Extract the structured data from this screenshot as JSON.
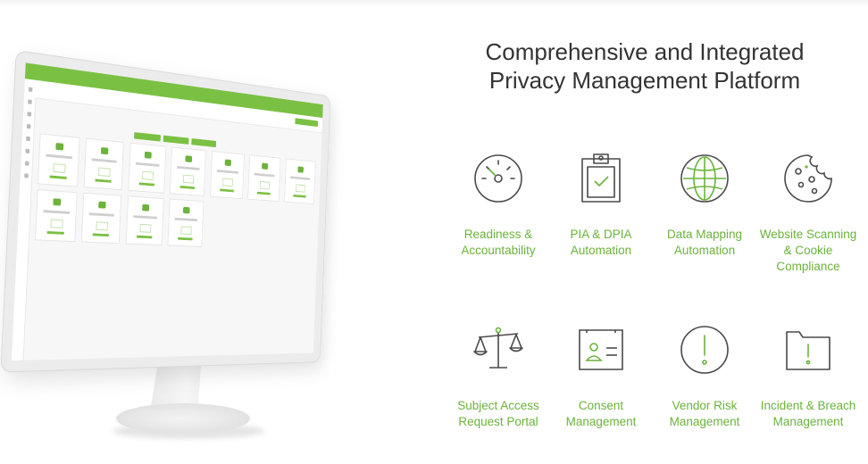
{
  "headline": {
    "line1": "Comprehensive and Integrated",
    "line2": "Privacy Management Platform"
  },
  "colors": {
    "accent": "#6bb33a",
    "icon_stroke": "#4a4a4a",
    "heading": "#333333"
  },
  "features": [
    {
      "label": "Readiness & Accountability",
      "icon": "speedometer-icon"
    },
    {
      "label": "PIA & DPIA Automation",
      "icon": "clipboard-check-icon"
    },
    {
      "label": "Data Mapping Automation",
      "icon": "globe-icon"
    },
    {
      "label": "Website Scanning & Cookie Compliance",
      "icon": "cookie-icon"
    },
    {
      "label": "Subject Access Request Portal",
      "icon": "scales-icon"
    },
    {
      "label": "Consent Management",
      "icon": "id-card-icon"
    },
    {
      "label": "Vendor Risk Management",
      "icon": "alert-circle-icon"
    },
    {
      "label": "Incident & Breach Management",
      "icon": "alert-folder-icon"
    }
  ]
}
